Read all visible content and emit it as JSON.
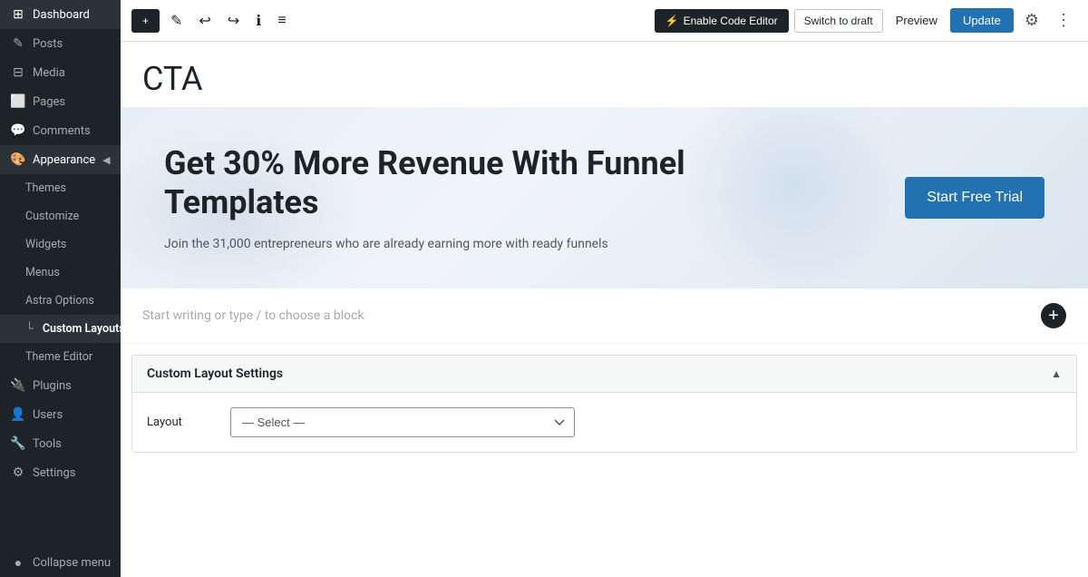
{
  "sidebar": {
    "items": [
      {
        "id": "dashboard",
        "label": "Dashboard",
        "icon": "⊞",
        "active": false
      },
      {
        "id": "posts",
        "label": "Posts",
        "icon": "✎",
        "active": false
      },
      {
        "id": "media",
        "label": "Media",
        "icon": "⊟",
        "active": false
      },
      {
        "id": "pages",
        "label": "Pages",
        "icon": "⬜",
        "active": false
      },
      {
        "id": "comments",
        "label": "Comments",
        "icon": "💬",
        "active": false
      },
      {
        "id": "appearance",
        "label": "Appearance",
        "icon": "🎨",
        "active": true
      },
      {
        "id": "plugins",
        "label": "Plugins",
        "icon": "🔌",
        "active": false
      },
      {
        "id": "users",
        "label": "Users",
        "icon": "👤",
        "active": false
      },
      {
        "id": "tools",
        "label": "Tools",
        "icon": "🔧",
        "active": false
      },
      {
        "id": "settings",
        "label": "Settings",
        "icon": "⚙",
        "active": false
      },
      {
        "id": "collapse",
        "label": "Collapse menu",
        "icon": "●",
        "active": false
      }
    ],
    "appearance_sub": [
      {
        "id": "themes",
        "label": "Themes",
        "active": false
      },
      {
        "id": "customize",
        "label": "Customize",
        "active": false
      },
      {
        "id": "widgets",
        "label": "Widgets",
        "active": false
      },
      {
        "id": "menus",
        "label": "Menus",
        "active": false
      },
      {
        "id": "astra-options",
        "label": "Astra Options",
        "active": false
      },
      {
        "id": "custom-layouts",
        "label": "Custom Layouts",
        "active": true
      },
      {
        "id": "theme-editor",
        "label": "Theme Editor",
        "active": false
      }
    ]
  },
  "topbar": {
    "add_label": "+",
    "edit_icon": "✎",
    "undo_icon": "↩",
    "redo_icon": "↪",
    "info_icon": "ℹ",
    "list_icon": "≡",
    "code_editor_label": "Enable Code Editor",
    "code_editor_icon": "⚡",
    "switch_label": "Switch to draft",
    "preview_label": "Preview",
    "update_label": "Update",
    "gear_icon": "⚙",
    "more_icon": "⋮"
  },
  "page": {
    "title": "CTA"
  },
  "cta_banner": {
    "heading": "Get 30% More Revenue With Funnel Templates",
    "subtext": "Join the 31,000 entrepreneurs who are already earning more with ready funnels",
    "button_label": "Start Free Trial"
  },
  "block_editor": {
    "placeholder": "Start writing or type / to choose a block"
  },
  "settings_panel": {
    "title": "Custom Layout Settings",
    "layout_label": "Layout",
    "layout_placeholder": "— Select —",
    "layout_options": [
      "— Select —"
    ],
    "collapse_icon": "▲"
  }
}
